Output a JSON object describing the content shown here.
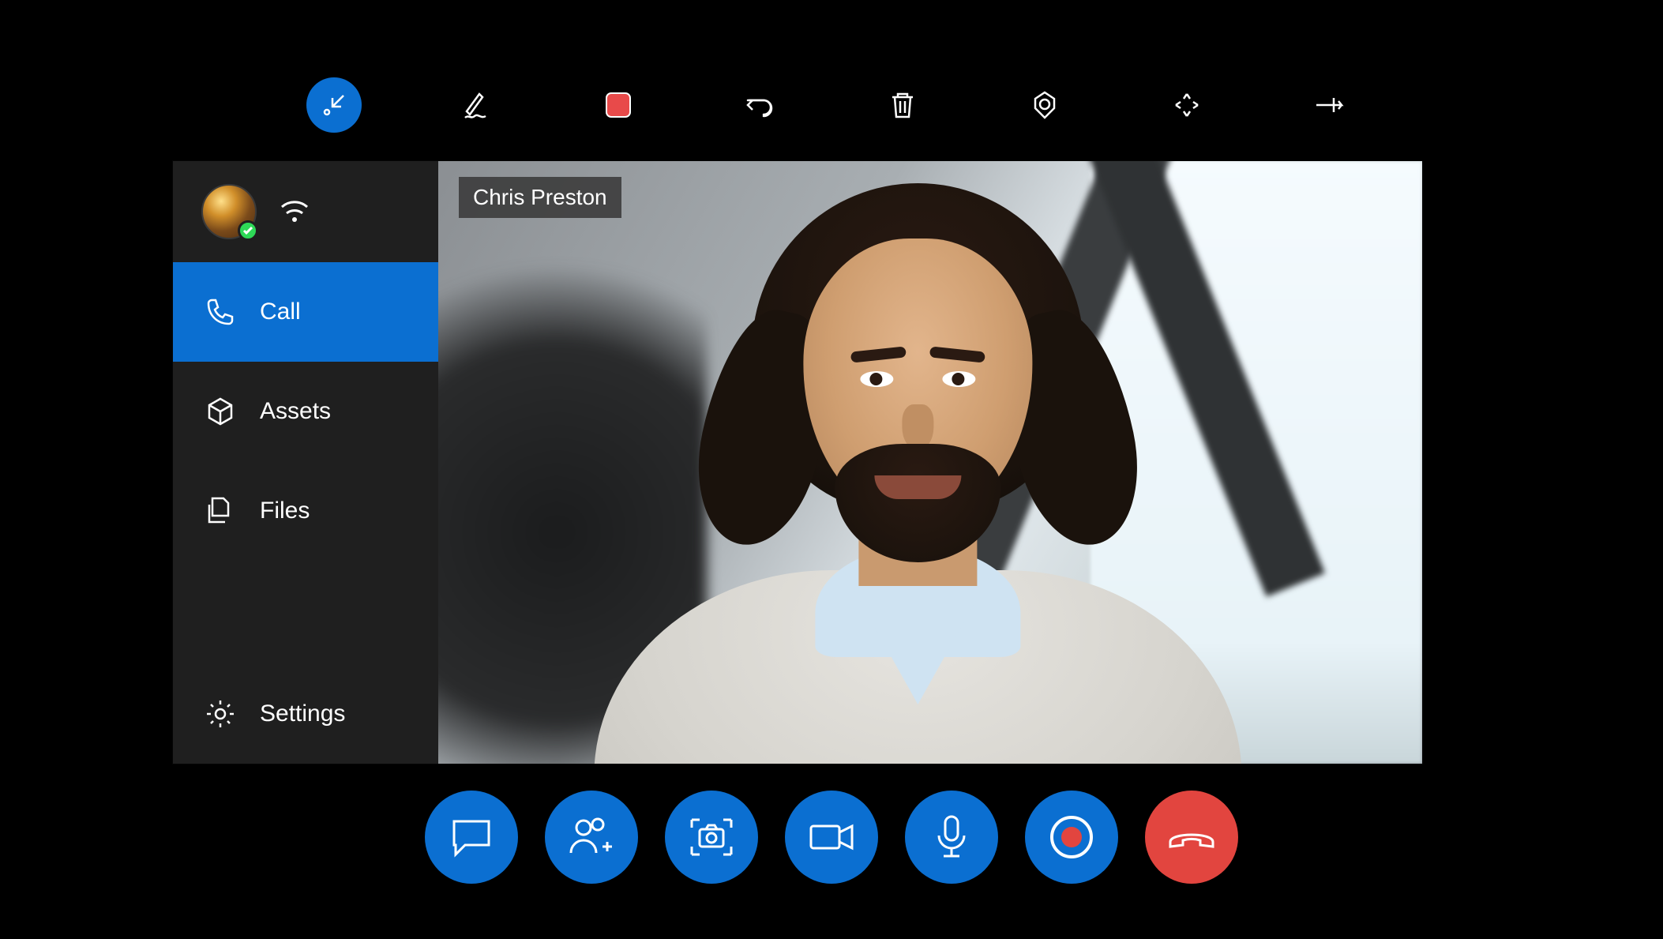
{
  "top_toolbar": {
    "items": [
      {
        "name": "collapse-icon",
        "active": true
      },
      {
        "name": "ink-icon",
        "active": false
      },
      {
        "name": "stop-recording-icon",
        "active": false
      },
      {
        "name": "undo-icon",
        "active": false
      },
      {
        "name": "trash-icon",
        "active": false
      },
      {
        "name": "target-icon",
        "active": false
      },
      {
        "name": "expand-icon",
        "active": false
      },
      {
        "name": "pin-icon",
        "active": false
      }
    ]
  },
  "sidebar": {
    "presence": "available",
    "items": [
      {
        "icon": "phone-icon",
        "label": "Call",
        "active": true
      },
      {
        "icon": "package-icon",
        "label": "Assets",
        "active": false
      },
      {
        "icon": "files-icon",
        "label": "Files",
        "active": false
      }
    ],
    "settings_label": "Settings"
  },
  "video": {
    "caller_name": "Chris Preston"
  },
  "controls": [
    {
      "name": "chat-button",
      "icon": "chat-icon"
    },
    {
      "name": "add-participant-button",
      "icon": "add-person-icon"
    },
    {
      "name": "snapshot-button",
      "icon": "camera-capture-icon"
    },
    {
      "name": "video-button",
      "icon": "video-icon"
    },
    {
      "name": "mic-button",
      "icon": "mic-icon"
    },
    {
      "name": "record-button",
      "icon": "record-icon"
    },
    {
      "name": "hangup-button",
      "icon": "hangup-icon"
    }
  ],
  "colors": {
    "primary": "#0b6fd1",
    "danger": "#e2453f",
    "record": "#e84a4a"
  }
}
